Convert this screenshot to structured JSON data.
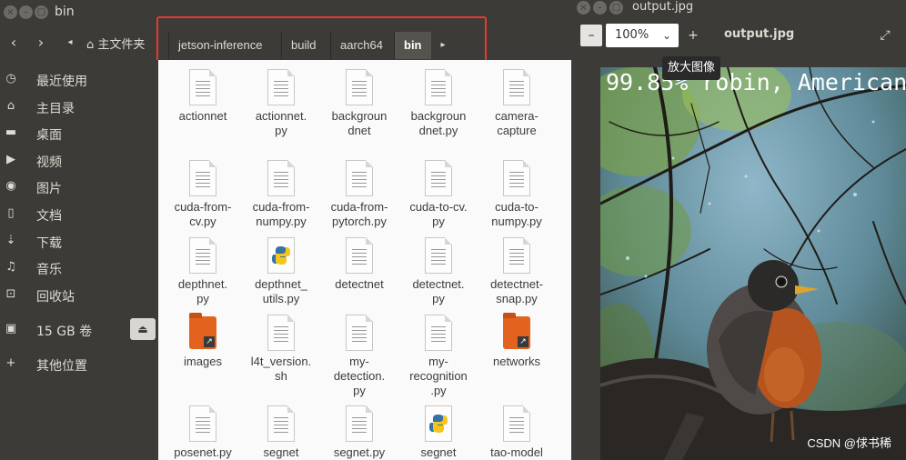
{
  "file_manager": {
    "window_title": "bin",
    "home_crumb": "主文件夹",
    "breadcrumbs": [
      "jetson-inference",
      "build",
      "aarch64",
      "bin"
    ],
    "sidebar": [
      {
        "label": "最近使用",
        "icon": "clock-icon"
      },
      {
        "label": "主目录",
        "icon": "home-icon"
      },
      {
        "label": "桌面",
        "icon": "folder-icon"
      },
      {
        "label": "视频",
        "icon": "video-icon"
      },
      {
        "label": "图片",
        "icon": "camera-icon"
      },
      {
        "label": "文档",
        "icon": "document-icon"
      },
      {
        "label": "下载",
        "icon": "download-icon"
      },
      {
        "label": "音乐",
        "icon": "music-icon"
      },
      {
        "label": "回收站",
        "icon": "trash-icon"
      },
      {
        "label": "15 GB 卷",
        "icon": "drive-icon"
      },
      {
        "label": "其他位置",
        "icon": "plus-icon"
      }
    ],
    "files": [
      {
        "name": "actionnet",
        "type": "doc"
      },
      {
        "name": "actionnet.\npy",
        "type": "doc"
      },
      {
        "name": "backgroun\ndnet",
        "type": "doc"
      },
      {
        "name": "backgroun\ndnet.py",
        "type": "doc"
      },
      {
        "name": "camera-\ncapture",
        "type": "doc"
      },
      {
        "name": "cuda-from-\ncv.py",
        "type": "doc"
      },
      {
        "name": "cuda-from-\nnumpy.py",
        "type": "doc"
      },
      {
        "name": "cuda-from-\npytorch.py",
        "type": "doc"
      },
      {
        "name": "cuda-to-cv.\npy",
        "type": "doc"
      },
      {
        "name": "cuda-to-\nnumpy.py",
        "type": "doc"
      },
      {
        "name": "depthnet.\npy",
        "type": "doc"
      },
      {
        "name": "depthnet_\nutils.py",
        "type": "python"
      },
      {
        "name": "detectnet",
        "type": "doc"
      },
      {
        "name": "detectnet.\npy",
        "type": "doc"
      },
      {
        "name": "detectnet-\nsnap.py",
        "type": "doc"
      },
      {
        "name": "images",
        "type": "folder"
      },
      {
        "name": "l4t_version.\nsh",
        "type": "doc"
      },
      {
        "name": "my-\ndetection.\npy",
        "type": "doc"
      },
      {
        "name": "my-\nrecognition\n.py",
        "type": "doc"
      },
      {
        "name": "networks",
        "type": "folder"
      },
      {
        "name": "posenet.py",
        "type": "doc"
      },
      {
        "name": "segnet",
        "type": "doc"
      },
      {
        "name": "segnet.py",
        "type": "doc"
      },
      {
        "name": "segnet",
        "type": "python"
      },
      {
        "name": "tao-model",
        "type": "doc"
      }
    ]
  },
  "image_viewer": {
    "window_title": "output.jpg",
    "zoom_value": "100%",
    "filename": "output.jpg",
    "tooltip": "放大图像",
    "overlay_text": "99.85% robin, American",
    "watermark": "CSDN @俅书稀"
  },
  "colors": {
    "highlight": "#e53b2f",
    "folder": "#e2621e",
    "titlebar": "#3c3b37"
  }
}
